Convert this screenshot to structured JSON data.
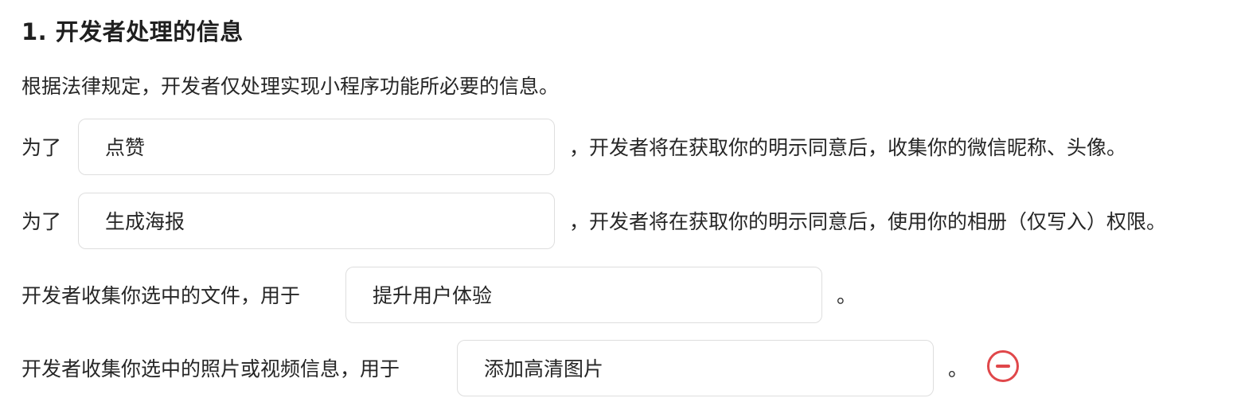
{
  "section": {
    "title": "1.  开发者处理的信息",
    "intro": "根据法律规定，开发者仅处理实现小程序功能所必要的信息。"
  },
  "rows": [
    {
      "prefix": "为了",
      "value": "点赞",
      "suffix": "，开发者将在获取你的明示同意后，收集你的微信昵称、头像。"
    },
    {
      "prefix": "为了",
      "value": "生成海报",
      "suffix": "，开发者将在获取你的明示同意后，使用你的相册（仅写入）权限。"
    },
    {
      "prefix": "开发者收集你选中的文件，用于",
      "value": "提升用户体验",
      "suffix": "。"
    },
    {
      "prefix": "开发者收集你选中的照片或视频信息，用于",
      "value": "添加高清图片",
      "suffix": "。"
    }
  ],
  "icons": {
    "remove": "minus-circle-icon"
  },
  "colors": {
    "text": "#262626",
    "border": "#dedede",
    "remove": "#e0474a"
  }
}
